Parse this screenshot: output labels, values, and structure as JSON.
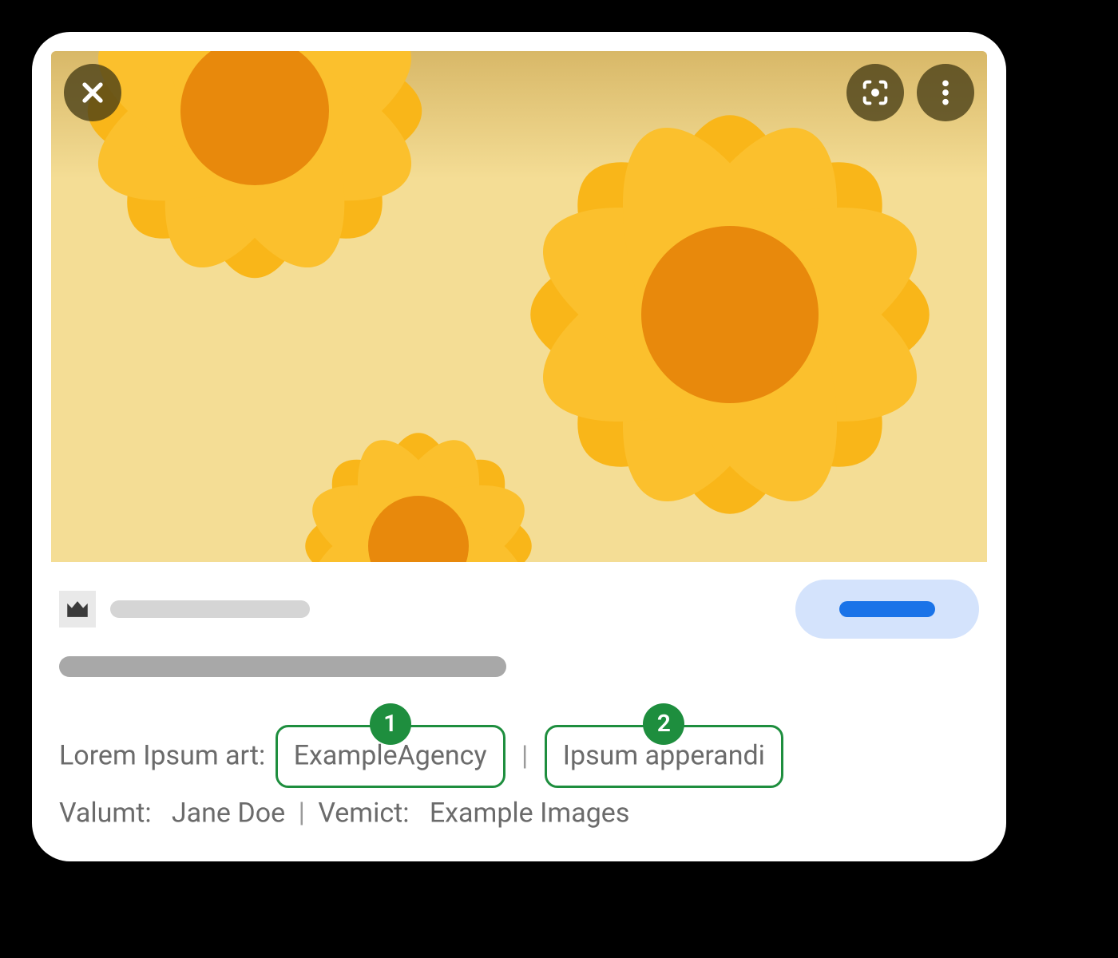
{
  "credits": {
    "line1_prefix": "Lorem Ipsum art:",
    "callout1_num": "1",
    "callout1_text": "ExampleAgency",
    "callout2_num": "2",
    "callout2_text": "Ipsum apperandi",
    "line2_label1": "Valumt:",
    "line2_value1": "Jane Doe",
    "line2_label2": "Vemict:",
    "line2_value2": "Example Images",
    "separator": "|"
  },
  "colors": {
    "accent_green": "#1e8e3e",
    "pill_bg": "#d4e3fc",
    "pill_fg": "#1a73e8"
  }
}
